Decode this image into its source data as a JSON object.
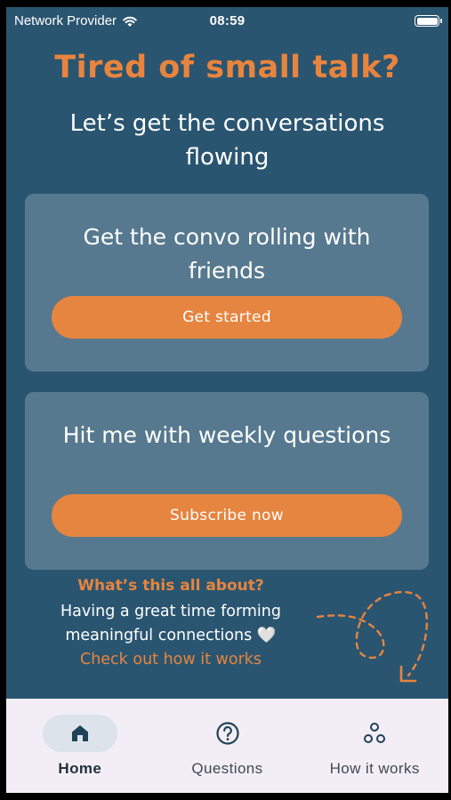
{
  "status_bar": {
    "carrier": "Network Provider",
    "time": "08:59",
    "wifi_icon": "wifi-icon",
    "battery_icon": "battery-full-icon"
  },
  "header": {
    "title": "Tired of small talk?",
    "subtitle": "Let’s get the conversations flowing"
  },
  "cards": [
    {
      "title": "Get the convo rolling with friends",
      "button_label": "Get started"
    },
    {
      "title": "Hit me with weekly questions",
      "button_label": "Subscribe now"
    }
  ],
  "info": {
    "heading": "What’s this all about?",
    "body": "Having a great time forming meaningful connections 🤍",
    "link": "Check out how it works"
  },
  "tab_bar": {
    "items": [
      {
        "label": "Home",
        "icon": "home-icon",
        "active": true
      },
      {
        "label": "Questions",
        "icon": "question-circle-icon",
        "active": false
      },
      {
        "label": "How it works",
        "icon": "three-circles-icon",
        "active": false
      }
    ]
  },
  "colors": {
    "background": "#2a5570",
    "card": "#56798f",
    "accent": "#e6853f",
    "tab_bar": "#f3eef5"
  }
}
